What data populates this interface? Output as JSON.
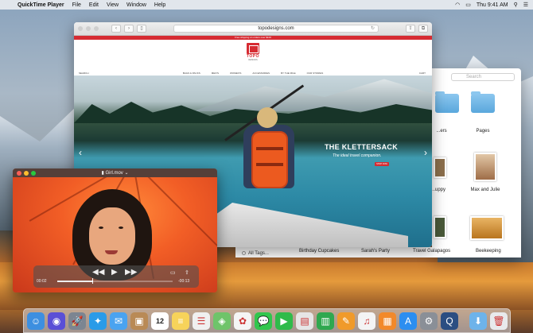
{
  "menubar": {
    "app_name": "QuickTime Player",
    "items": [
      "File",
      "Edit",
      "View",
      "Window",
      "Help"
    ],
    "clock": "Thu 9:41 AM"
  },
  "safari": {
    "url": "topodesigns.com",
    "promo": "Free shipping on orders over $100",
    "logo_text": "TOPO",
    "logo_sub": "DESIGNS",
    "nav_search": "SEARCH",
    "nav_items": [
      "BAGS & PACKS",
      "MEN'S",
      "WOMEN'S",
      "ACCESSORIES",
      "BY THE MILE",
      "OUR STORIES"
    ],
    "nav_cart": "CART",
    "hero_title": "THE KLETTERSACK",
    "hero_subtitle": "The ideal travel companion.",
    "hero_button": "SHOP NOW"
  },
  "finder": {
    "search_placeholder": "Search",
    "items": [
      {
        "label": "...ers"
      },
      {
        "label": "Pages"
      },
      {
        "label": "...uppy"
      },
      {
        "label": "Max and Julie"
      },
      {
        "label": "Birthday Cupcakes"
      },
      {
        "label": "Sarah's Party"
      },
      {
        "label": "Travel Galapagos"
      },
      {
        "label": "Beekeeping"
      }
    ],
    "tags_label": "All Tags..."
  },
  "quicktime": {
    "file_name": "Girl.mov",
    "time_elapsed": "00:02",
    "time_remaining": "-00:13",
    "progress_fraction": 0.3
  },
  "dock": {
    "apps": [
      {
        "name": "finder-icon",
        "color": "#3d8fe0",
        "glyph": "☺"
      },
      {
        "name": "siri-icon",
        "color": "#5a4fd6",
        "glyph": "◉"
      },
      {
        "name": "launchpad-icon",
        "color": "#7c8591",
        "glyph": "🚀"
      },
      {
        "name": "safari-icon",
        "color": "#2a9be8",
        "glyph": "✦"
      },
      {
        "name": "mail-icon",
        "color": "#4aa3f0",
        "glyph": "✉"
      },
      {
        "name": "contacts-icon",
        "color": "#b98a56",
        "glyph": "▣"
      },
      {
        "name": "calendar-icon",
        "color": "#ffffff",
        "glyph": "12"
      },
      {
        "name": "notes-icon",
        "color": "#f7d35a",
        "glyph": "≡"
      },
      {
        "name": "reminders-icon",
        "color": "#f0f0f0",
        "glyph": "☰"
      },
      {
        "name": "maps-icon",
        "color": "#6fc46a",
        "glyph": "◈"
      },
      {
        "name": "photos-icon",
        "color": "#f5f5f5",
        "glyph": "✿"
      },
      {
        "name": "messages-icon",
        "color": "#31c64d",
        "glyph": "💬"
      },
      {
        "name": "facetime-icon",
        "color": "#2fbb4a",
        "glyph": "▶"
      },
      {
        "name": "keynote-icon",
        "color": "#e6e6e6",
        "glyph": "▤"
      },
      {
        "name": "numbers-icon",
        "color": "#2fa84f",
        "glyph": "▥"
      },
      {
        "name": "pages-icon",
        "color": "#f09a2a",
        "glyph": "✎"
      },
      {
        "name": "itunes-icon",
        "color": "#f4f4f4",
        "glyph": "♫"
      },
      {
        "name": "ibooks-icon",
        "color": "#f2892a",
        "glyph": "▦"
      },
      {
        "name": "app-store-icon",
        "color": "#2c8ef0",
        "glyph": "A"
      },
      {
        "name": "system-preferences-icon",
        "color": "#8a8f97",
        "glyph": "⚙"
      },
      {
        "name": "quicktime-icon",
        "color": "#2b4e82",
        "glyph": "Q"
      }
    ],
    "trailing": [
      {
        "name": "downloads-folder-icon",
        "color": "#6db3ea",
        "glyph": "⬇"
      },
      {
        "name": "trash-icon",
        "color": "#e8eaec",
        "glyph": "🗑"
      }
    ]
  }
}
